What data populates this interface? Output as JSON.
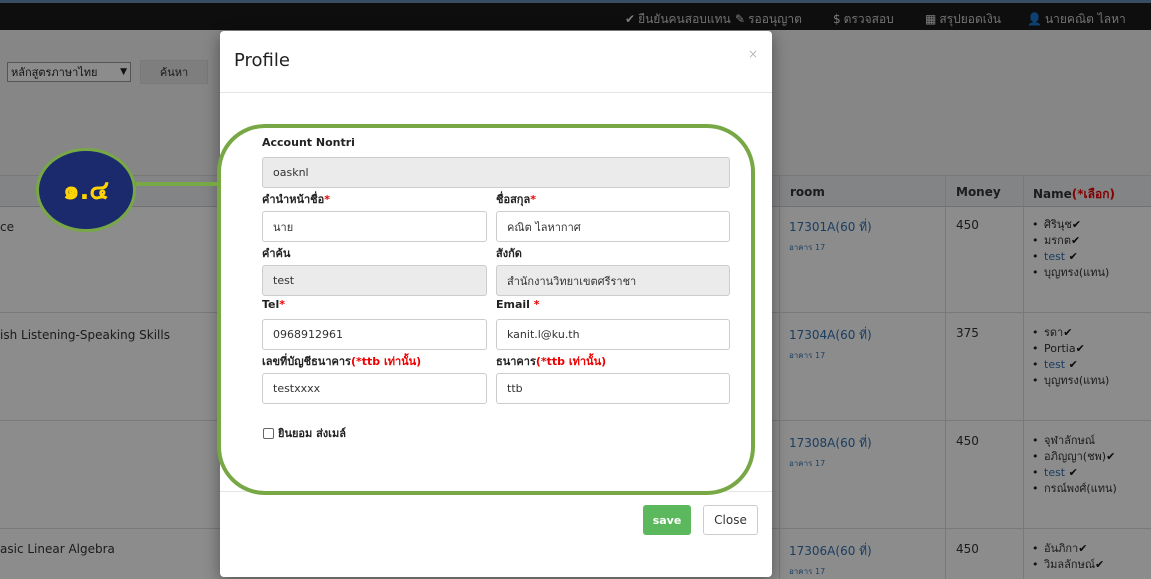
{
  "nav": {
    "items": [
      {
        "icon": "check-circle-icon",
        "label": "ยืนยันคนสอบแทน"
      },
      {
        "icon": "edit-icon",
        "label": "รออนุญาต"
      },
      {
        "icon": "dollar-icon",
        "label": "ตรวจสอบ"
      },
      {
        "icon": "calculator-icon",
        "label": "สรุปยอดเงิน"
      },
      {
        "icon": "user-icon",
        "label": "นายคณิต ไลหา"
      }
    ]
  },
  "filter": {
    "course_select": "หลักสูตรภาษาไทย",
    "search_label": "ค้นหา"
  },
  "table": {
    "headers": {
      "room": "room",
      "money": "Money",
      "name": "Name",
      "name_note": "(*เลือก)"
    },
    "rows": [
      {
        "subject": "ce",
        "room": "17301A(60 ที่)",
        "building": "อาคาร 17",
        "money": "450",
        "names": [
          {
            "text": "ศิรินุช",
            "check": true,
            "link": false
          },
          {
            "text": "มรกต",
            "check": true,
            "link": false
          },
          {
            "text": "test",
            "check": true,
            "link": true
          },
          {
            "text": "บุญทรง(แทน)",
            "check": false,
            "link": false
          }
        ]
      },
      {
        "subject": "ish Listening-Speaking Skills",
        "room": "17304A(60 ที่)",
        "building": "อาคาร 17",
        "money": "375",
        "names": [
          {
            "text": "รดา",
            "check": true,
            "link": false
          },
          {
            "text": "Portia",
            "check": true,
            "link": false
          },
          {
            "text": "test",
            "check": true,
            "link": true
          },
          {
            "text": "บุญทรง(แทน)",
            "check": false,
            "link": false
          }
        ]
      },
      {
        "subject": "",
        "room": "17308A(60 ที่)",
        "building": "อาคาร 17",
        "money": "450",
        "names": [
          {
            "text": "จุฬาลักษณ์",
            "check": false,
            "link": false
          },
          {
            "text": "อภิญญา(ชพ)",
            "check": true,
            "link": false
          },
          {
            "text": "test",
            "check": true,
            "link": true
          },
          {
            "text": "กรณ์พงศ์(แทน)",
            "check": false,
            "link": false
          }
        ]
      },
      {
        "subject": "asic Linear Algebra",
        "room": "17306A(60 ที่)",
        "building": "อาคาร 17",
        "money": "450",
        "names": [
          {
            "text": "อันภิกา",
            "check": true,
            "link": false
          },
          {
            "text": "วิมลลักษณ์",
            "check": true,
            "link": false
          }
        ]
      }
    ]
  },
  "modal": {
    "title": "Profile",
    "close_x": "×",
    "account_label": "Account Nontri",
    "account_value": "oasknl",
    "prefix_label": "คำนำหน้าชื่อ",
    "prefix_value": "นาย",
    "surname_label": "ชื่อสกุล",
    "surname_value": "คณิต ไลหากาศ",
    "keyword_label": "คำค้น",
    "keyword_value": "test",
    "affiliation_label": "สังกัด",
    "affiliation_value": "สำนักงานวิทยาเขตศรีราชา",
    "tel_label": "Tel",
    "tel_value": "0968912961",
    "email_label": "Email",
    "email_value": "kanit.l@ku.th",
    "bank_acc_label": "เลขที่บัญชีธนาคาร",
    "bank_acc_note": "(*ttb เท่านั้น)",
    "bank_acc_value": "testxxxx",
    "bank_label": "ธนาคาร",
    "bank_note": "(*ttb เท่านั้น)",
    "bank_value": "ttb",
    "consent_label": "ยินยอม ส่งเมล์",
    "required_mark": "*",
    "save_label": "save",
    "close_label": "Close"
  },
  "annotation": {
    "badge_text": "๑.๔",
    "ring_color": "#78a845",
    "badge_color": "#1a2a6c",
    "badge_text_color": "#ffd400"
  }
}
